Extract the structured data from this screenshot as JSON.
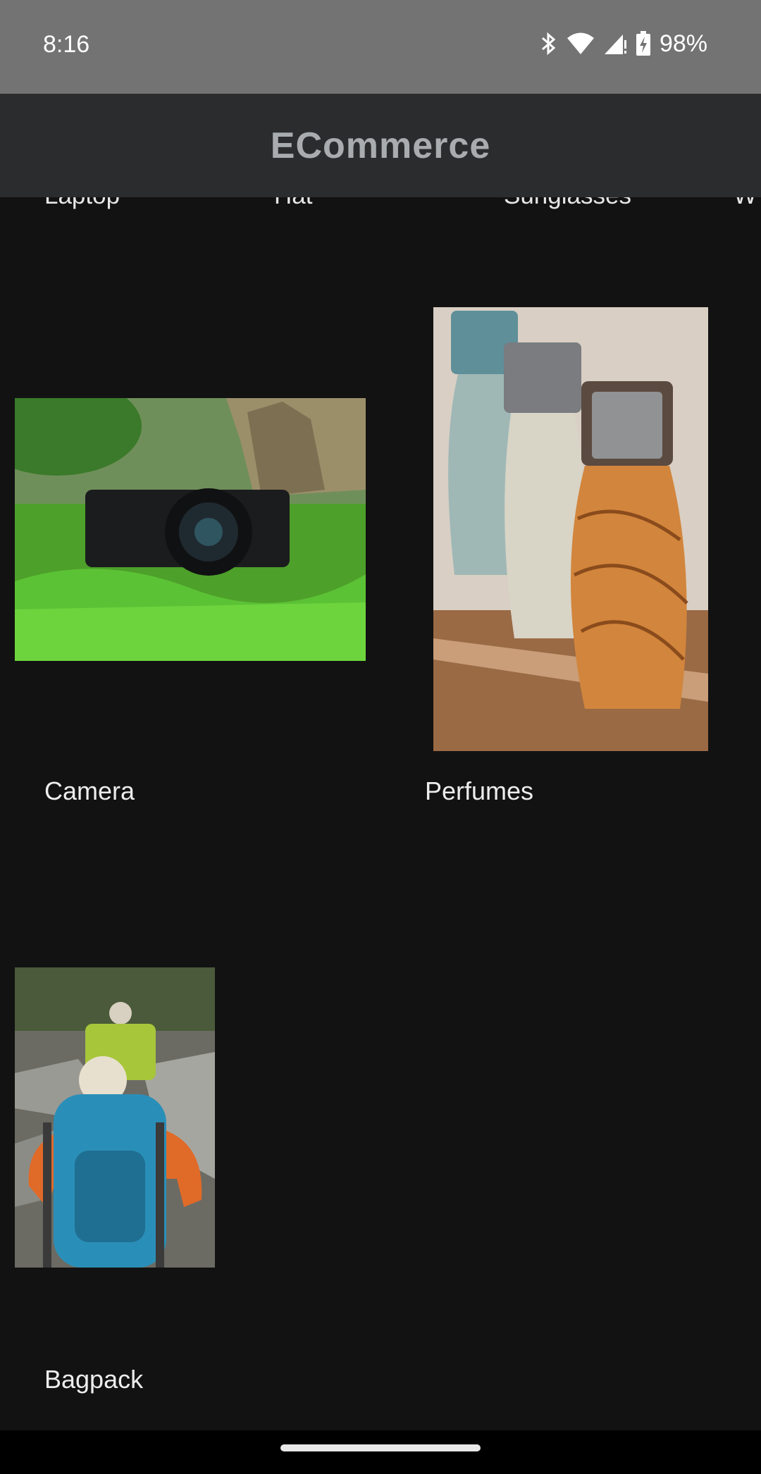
{
  "status": {
    "time": "8:16",
    "battery": "98%",
    "icons": [
      "bluetooth-icon",
      "wifi-icon",
      "signal-icon",
      "battery-charging-icon"
    ]
  },
  "app": {
    "title": "ECommerce",
    "title_color": "#a9acaf",
    "bar_color": "#2b2c2e",
    "background": "#121212"
  },
  "categories": [
    "Laptop",
    "Hat",
    "Sunglasses",
    "W"
  ],
  "products": [
    {
      "label": "Camera",
      "image": "camera-in-grass-image"
    },
    {
      "label": "Perfumes",
      "image": "perfume-bottles-image"
    },
    {
      "label": "Bagpack",
      "image": "hikers-backpack-image"
    }
  ]
}
